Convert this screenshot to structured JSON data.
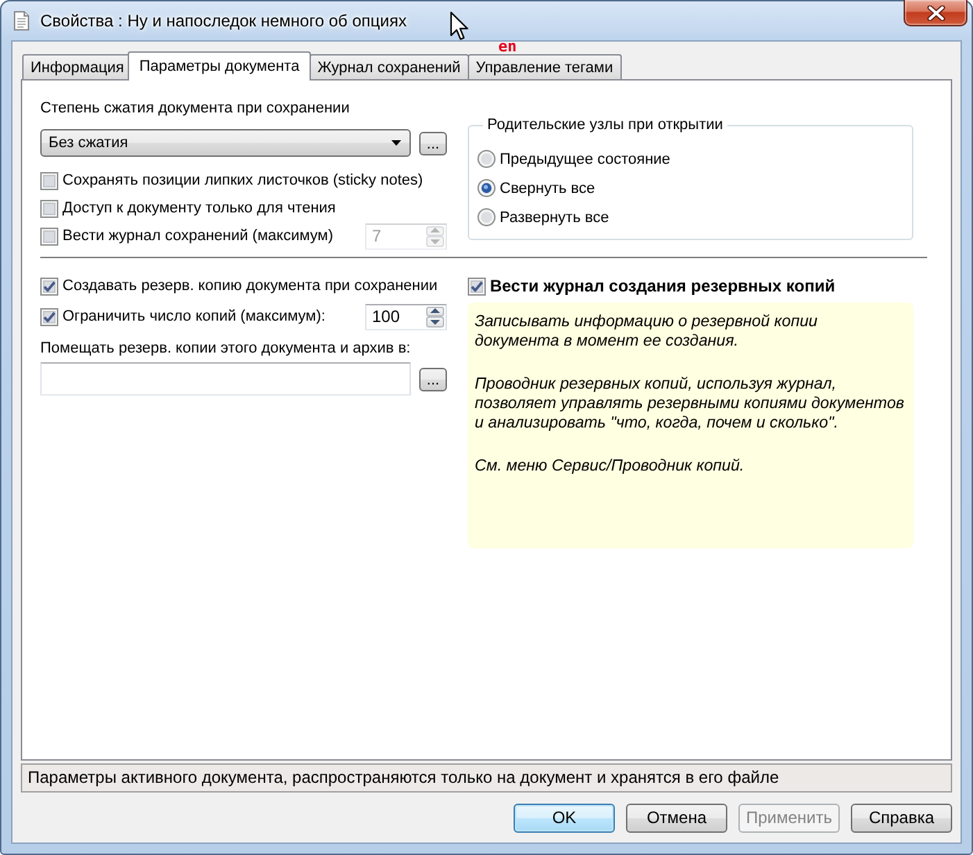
{
  "window": {
    "title": "Свойства : Ну и напоследок немного об опциях"
  },
  "input_language_indicator": "en",
  "tabs": [
    {
      "label": "Информация",
      "selected": false
    },
    {
      "label": "Параметры документа",
      "selected": true
    },
    {
      "label": "Журнал сохранений",
      "selected": false
    },
    {
      "label": "Управление тегами",
      "selected": false
    }
  ],
  "compression": {
    "label": "Степень сжатия документа при сохранении",
    "value": "Без сжатия",
    "button": "..."
  },
  "options": [
    {
      "label": "Сохранять позиции липких листочков (sticky notes)",
      "checked": false
    },
    {
      "label": "Доступ к документу только для чтения",
      "checked": false
    },
    {
      "label": "Вести журнал сохранений (максимум)",
      "checked": false,
      "spinner": {
        "value": "7",
        "disabled": true
      }
    }
  ],
  "parent_nodes": {
    "title": "Родительские узлы при открытии",
    "options": [
      {
        "label": "Предыдущее состояние",
        "selected": false
      },
      {
        "label": "Свернуть все",
        "selected": true
      },
      {
        "label": "Развернуть все",
        "selected": false
      }
    ]
  },
  "backup": {
    "options": [
      {
        "label": "Создавать резерв. копию документа при сохранении",
        "checked": true
      },
      {
        "label": "Ограничить число копий (максимум):",
        "checked": true,
        "spinner": {
          "value": "100",
          "disabled": false
        }
      }
    ],
    "location": {
      "label": "Помещать резерв. копии этого документа и архив в:",
      "button": "..."
    }
  },
  "backup_log": {
    "label": "Вести журнал создания резервных копий",
    "checked": true,
    "description": [
      "Записывать информацию о резервной копии\nдокумента в момент ее создания.",
      "Проводник резервных копий, используя журнал,\nпозволяет управлять резервными копиями документов\nи анализировать \"что, когда, почем и сколько\".",
      "См. меню Сервис/Проводник копий."
    ]
  },
  "status_text": "Параметры активного документа, распространяются только на документ и хранятся в его файле",
  "buttons": [
    {
      "label": "OK",
      "default": true,
      "disabled": false
    },
    {
      "label": "Отмена",
      "default": false,
      "disabled": false
    },
    {
      "label": "Применить",
      "default": false,
      "disabled": true
    },
    {
      "label": "Справка",
      "default": false,
      "disabled": false
    }
  ]
}
